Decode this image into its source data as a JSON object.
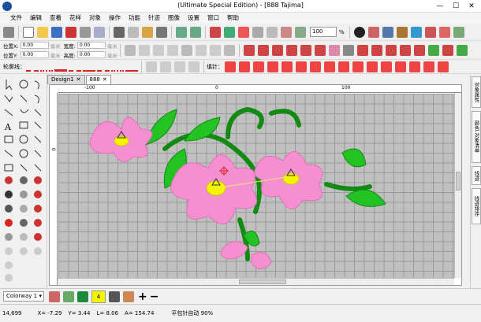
{
  "window": {
    "title": "(Ultimate Special Edition) - [888    Tajima]",
    "minimize": "—",
    "maximize": "☐",
    "close": "✕"
  },
  "menu": [
    "文件",
    "编辑",
    "查看",
    "花样",
    "对象",
    "操作",
    "功能",
    "针迹",
    "图像",
    "设置",
    "窗口",
    "帮助"
  ],
  "position": {
    "x_label": "位置X:",
    "y_label": "位置Y:",
    "width_label": "宽度:",
    "height_label": "高度:",
    "x_value": "0.00",
    "y_value": "0.00",
    "width_value": "0.00",
    "height_value": "0.00",
    "unit": "毫米"
  },
  "zoom": {
    "value": "100",
    "unit": "%"
  },
  "outline_label": "轮廓线：",
  "fill_label": "填针：",
  "tabs": [
    {
      "label": "Design1",
      "close": "✕"
    },
    {
      "label": "888",
      "close": "✕"
    }
  ],
  "rulers": {
    "top_minus100": "-100",
    "top_zero": "0",
    "top_100": "100",
    "left_zero": "0"
  },
  "right_tabs": [
    "对象属性",
    "颜色-对象清单",
    "线迹",
    "线迹排序"
  ],
  "colorway": {
    "label": "Colorway 1",
    "stop_number": "4"
  },
  "status": {
    "stitches": "14,699",
    "x": "X=  -7.29",
    "y": "Y=  3.44",
    "length": "L=  8.06",
    "angle": "A=  154.74",
    "message": "平包针自动 90%"
  },
  "colors": {
    "pink": "#f48fd0",
    "pink_stroke": "#e070b8",
    "green": "#22c322",
    "dark_green": "#138a13",
    "yellow": "#f5f500",
    "canvas": "#c0c0c0"
  }
}
